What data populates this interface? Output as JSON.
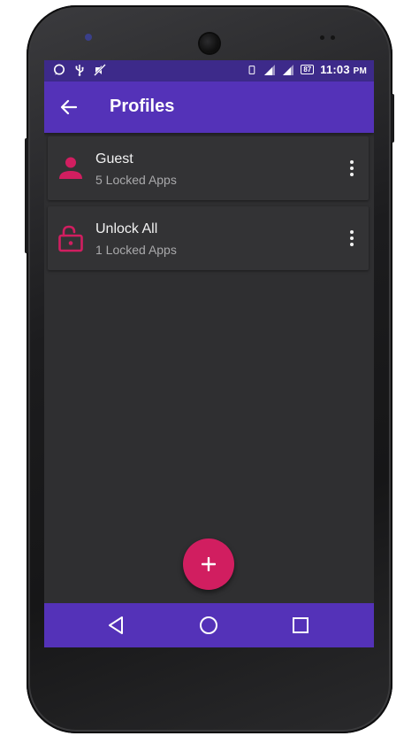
{
  "status_bar": {
    "icons_left": [
      "whatsapp-icon",
      "usb-icon",
      "mute-icon"
    ],
    "icons_right": [
      "phone-outline-icon",
      "signal-icon",
      "signal-icon",
      "battery-icon"
    ],
    "battery_label": "87",
    "time": "11:03",
    "ampm": "PM"
  },
  "app_bar": {
    "back_icon": "arrow-left-icon",
    "title": "Profiles"
  },
  "profiles": [
    {
      "name": "Guest",
      "subtitle": "5 Locked Apps",
      "icon": "person-icon"
    },
    {
      "name": "Unlock All",
      "subtitle": "1 Locked Apps",
      "icon": "unlocked-lock-icon"
    }
  ],
  "fab": {
    "icon": "plus-icon",
    "label": "+"
  },
  "nav_bar": {
    "buttons": [
      "back-triangle-icon",
      "home-circle-icon",
      "recents-square-icon"
    ]
  },
  "colors": {
    "primary": "#5432b8",
    "status_bar": "#3d2a8a",
    "accent": "#d11e60",
    "background": "#2f2f31",
    "card": "#333335"
  }
}
